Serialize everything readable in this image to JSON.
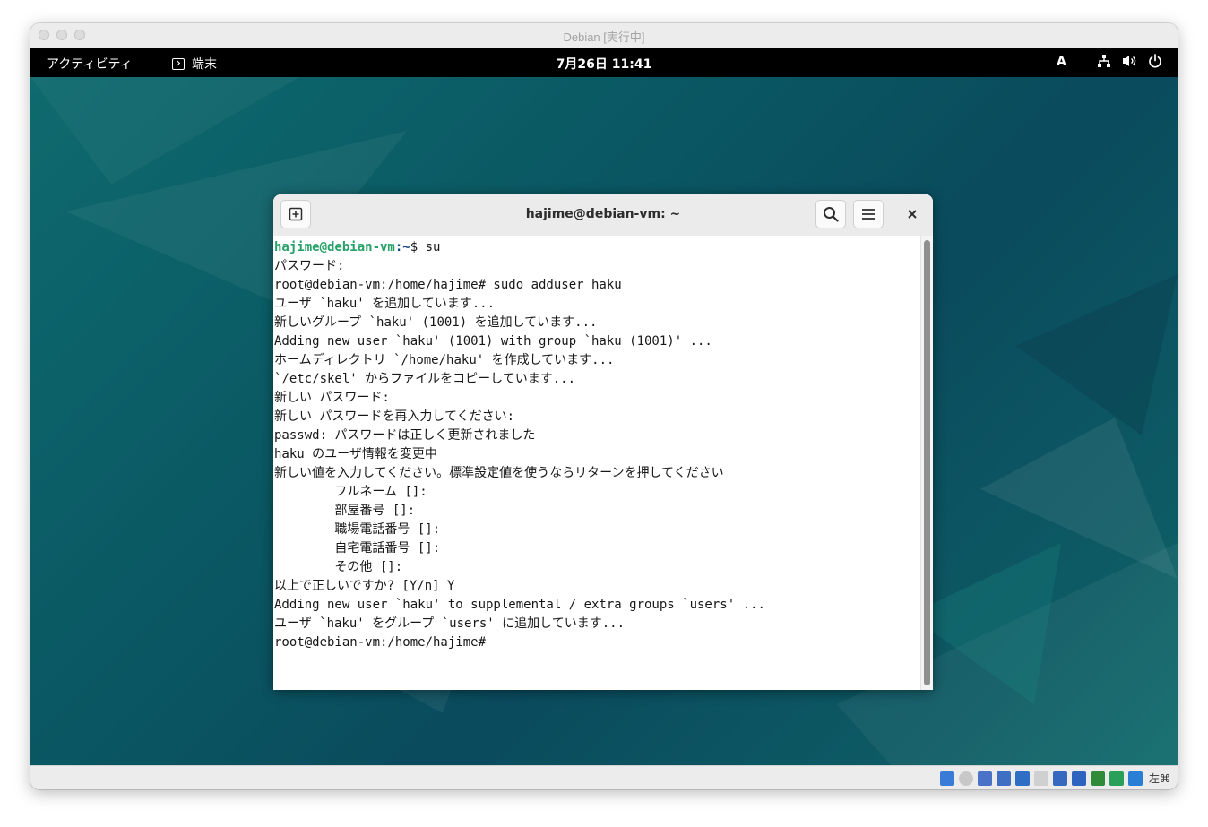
{
  "vm_window": {
    "title": "Debian [実行中]"
  },
  "topbar": {
    "activities": "アクティビティ",
    "app_name": "端末",
    "clock": "7月26日 11:41",
    "input_method": "A",
    "icons": [
      "network-icon",
      "volume-icon",
      "power-icon"
    ]
  },
  "terminal": {
    "title": "hajime@debian-vm: ~",
    "new_tab_icon": "new-tab-icon",
    "search_icon": "search-icon",
    "menu_icon": "hamburger-menu-icon",
    "close_icon": "close-icon",
    "prompt": {
      "user": "hajime@debian-vm",
      "path": ":~",
      "symbol": "$ ",
      "command": "su"
    },
    "lines": [
      "パスワード:",
      "root@debian-vm:/home/hajime# sudo adduser haku",
      "ユーザ `haku' を追加しています...",
      "新しいグループ `haku' (1001) を追加しています...",
      "Adding new user `haku' (1001) with group `haku (1001)' ...",
      "ホームディレクトリ `/home/haku' を作成しています...",
      "`/etc/skel' からファイルをコピーしています...",
      "新しい パスワード:",
      "新しい パスワードを再入力してください:",
      "passwd: パスワードは正しく更新されました",
      "haku のユーザ情報を変更中",
      "新しい値を入力してください。標準設定値を使うならリターンを押してください",
      "        フルネーム []:",
      "        部屋番号 []:",
      "        職場電話番号 []:",
      "        自宅電話番号 []:",
      "        その他 []:",
      "以上で正しいですか? [Y/n] Y",
      "Adding new user `haku' to supplemental / extra groups `users' ...",
      "ユーザ `haku' をグループ `users' に追加しています...",
      "root@debian-vm:/home/hajime#"
    ]
  },
  "statusbar": {
    "icons": [
      {
        "name": "hard-disk-icon",
        "color": "#3b7bd8"
      },
      {
        "name": "optical-drive-icon",
        "color": "#c8c8c8"
      },
      {
        "name": "audio-icon",
        "color": "#4a73c7"
      },
      {
        "name": "network-adapter-icon",
        "color": "#3e6fc2"
      },
      {
        "name": "usb-icon",
        "color": "#2f6ec5"
      },
      {
        "name": "shared-folder-icon",
        "color": "#d0d0d0"
      },
      {
        "name": "display-icon",
        "color": "#3568be"
      },
      {
        "name": "video-capture-icon",
        "color": "#2f63c0"
      },
      {
        "name": "recording-icon",
        "color": "#2f8a3a"
      },
      {
        "name": "cpu-icon",
        "color": "#28a05a"
      },
      {
        "name": "mouse-integration-icon",
        "color": "#2a7fd4"
      }
    ],
    "host_key": "左⌘"
  }
}
